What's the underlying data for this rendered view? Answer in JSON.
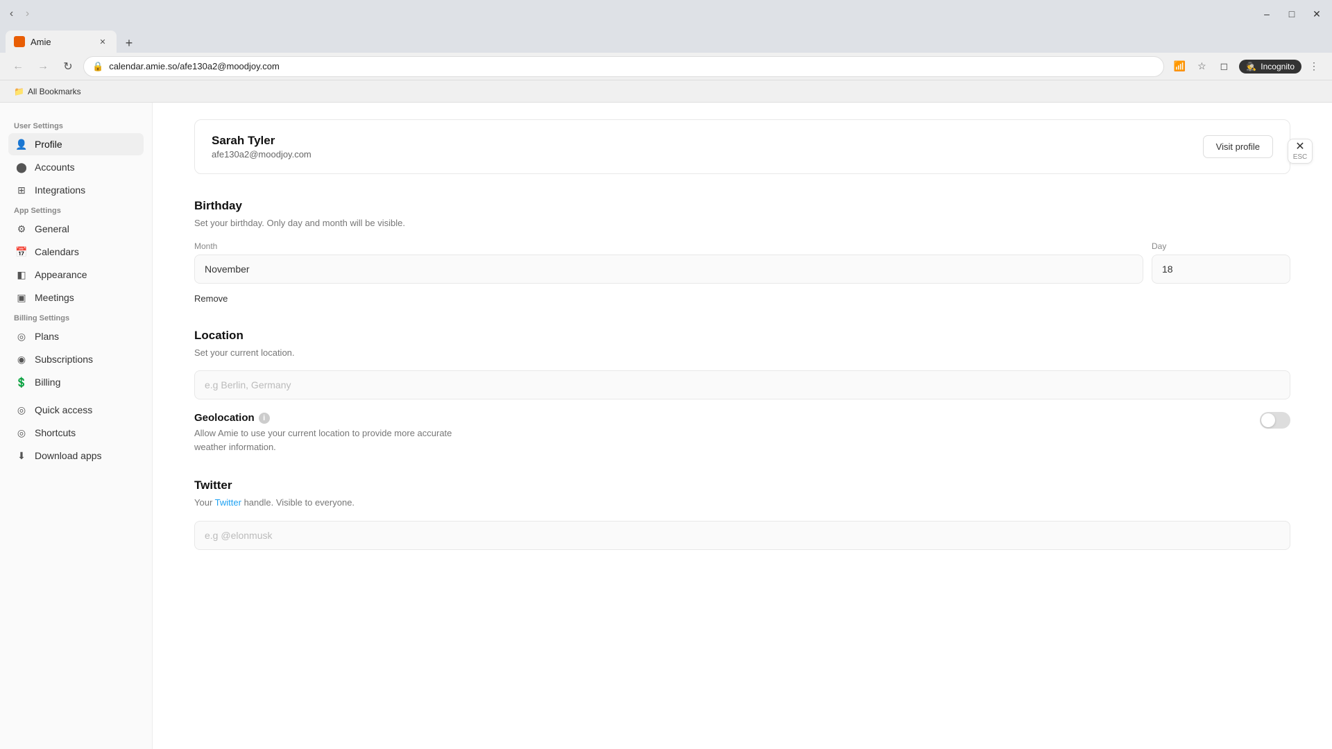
{
  "browser": {
    "tab_title": "Amie",
    "tab_favicon_color": "#e85d04",
    "address": "calendar.amie.so/afe130a2@moodjoy.com",
    "incognito_label": "Incognito",
    "bookmarks_bar_label": "All Bookmarks"
  },
  "close_button": {
    "label": "×",
    "esc_label": "ESC"
  },
  "sidebar": {
    "user_settings_label": "User Settings",
    "app_settings_label": "App Settings",
    "billing_settings_label": "Billing Settings",
    "items": [
      {
        "id": "profile",
        "label": "Profile",
        "icon": "👤",
        "active": true,
        "section": "user"
      },
      {
        "id": "accounts",
        "label": "Accounts",
        "icon": "⬤",
        "active": false,
        "section": "user"
      },
      {
        "id": "integrations",
        "label": "Integrations",
        "icon": "⊞",
        "active": false,
        "section": "user"
      },
      {
        "id": "general",
        "label": "General",
        "icon": "⚙",
        "active": false,
        "section": "app"
      },
      {
        "id": "calendars",
        "label": "Calendars",
        "icon": "📅",
        "active": false,
        "section": "app"
      },
      {
        "id": "appearance",
        "label": "Appearance",
        "icon": "◧",
        "active": false,
        "section": "app"
      },
      {
        "id": "meetings",
        "label": "Meetings",
        "icon": "▣",
        "active": false,
        "section": "app"
      },
      {
        "id": "plans",
        "label": "Plans",
        "icon": "◎",
        "active": false,
        "section": "billing"
      },
      {
        "id": "subscriptions",
        "label": "Subscriptions",
        "icon": "◉",
        "active": false,
        "section": "billing"
      },
      {
        "id": "billing",
        "label": "Billing",
        "icon": "💲",
        "active": false,
        "section": "billing"
      },
      {
        "id": "quick-access",
        "label": "Quick access",
        "icon": "◎",
        "active": false,
        "section": "extra"
      },
      {
        "id": "shortcuts",
        "label": "Shortcuts",
        "icon": "◎",
        "active": false,
        "section": "extra"
      },
      {
        "id": "download-apps",
        "label": "Download apps",
        "icon": "⬇",
        "active": false,
        "section": "extra"
      }
    ]
  },
  "profile_card": {
    "name": "Sarah Tyler",
    "email": "afe130a2@moodjoy.com",
    "visit_button": "Visit profile"
  },
  "birthday_section": {
    "title": "Birthday",
    "description": "Set your birthday. Only day and month will be visible.",
    "month_label": "Month",
    "month_value": "November",
    "day_label": "Day",
    "day_value": "18",
    "remove_label": "Remove"
  },
  "location_section": {
    "title": "Location",
    "description": "Set your current location.",
    "placeholder": "e.g Berlin, Germany",
    "value": ""
  },
  "geolocation": {
    "title": "Geolocation",
    "description": "Allow Amie to use your current location to provide more accurate weather information.",
    "enabled": false
  },
  "twitter_section": {
    "title": "Twitter",
    "description_prefix": "Your ",
    "link_text": "Twitter",
    "description_suffix": " handle. Visible to everyone.",
    "placeholder": "e.g @elonmusk",
    "value": ""
  }
}
